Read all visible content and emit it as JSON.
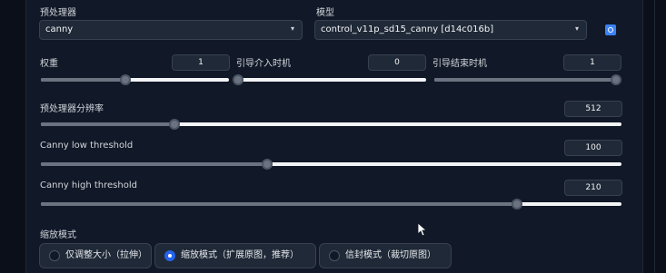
{
  "preprocessor": {
    "label": "预处理器",
    "value": "canny"
  },
  "model": {
    "label": "模型",
    "value": "control_v11p_sd15_canny [d14c016b]"
  },
  "weight": {
    "label": "权重",
    "value": "1",
    "fraction": 0.45
  },
  "guidance_start": {
    "label": "引导介入时机",
    "value": "0",
    "fraction": 0.0
  },
  "guidance_end": {
    "label": "引导结束时机",
    "value": "1",
    "fraction": 1.0
  },
  "resolution": {
    "label": "预处理器分辨率",
    "value": "512",
    "fraction": 0.23
  },
  "low_threshold": {
    "label": "Canny low threshold",
    "value": "100",
    "fraction": 0.39
  },
  "high_threshold": {
    "label": "Canny high threshold",
    "value": "210",
    "fraction": 0.82
  },
  "resize_mode": {
    "label": "缩放模式",
    "options": [
      "仅调整大小（拉伸）",
      "缩放模式（扩展原图，推荐）",
      "信封模式（裁切原图）"
    ],
    "selected_index": 1
  },
  "colors": {
    "accent": "#2563eb",
    "background": "#111827"
  },
  "icons": {
    "refresh": "refresh-icon",
    "dropdown": "chevron-down-icon"
  }
}
